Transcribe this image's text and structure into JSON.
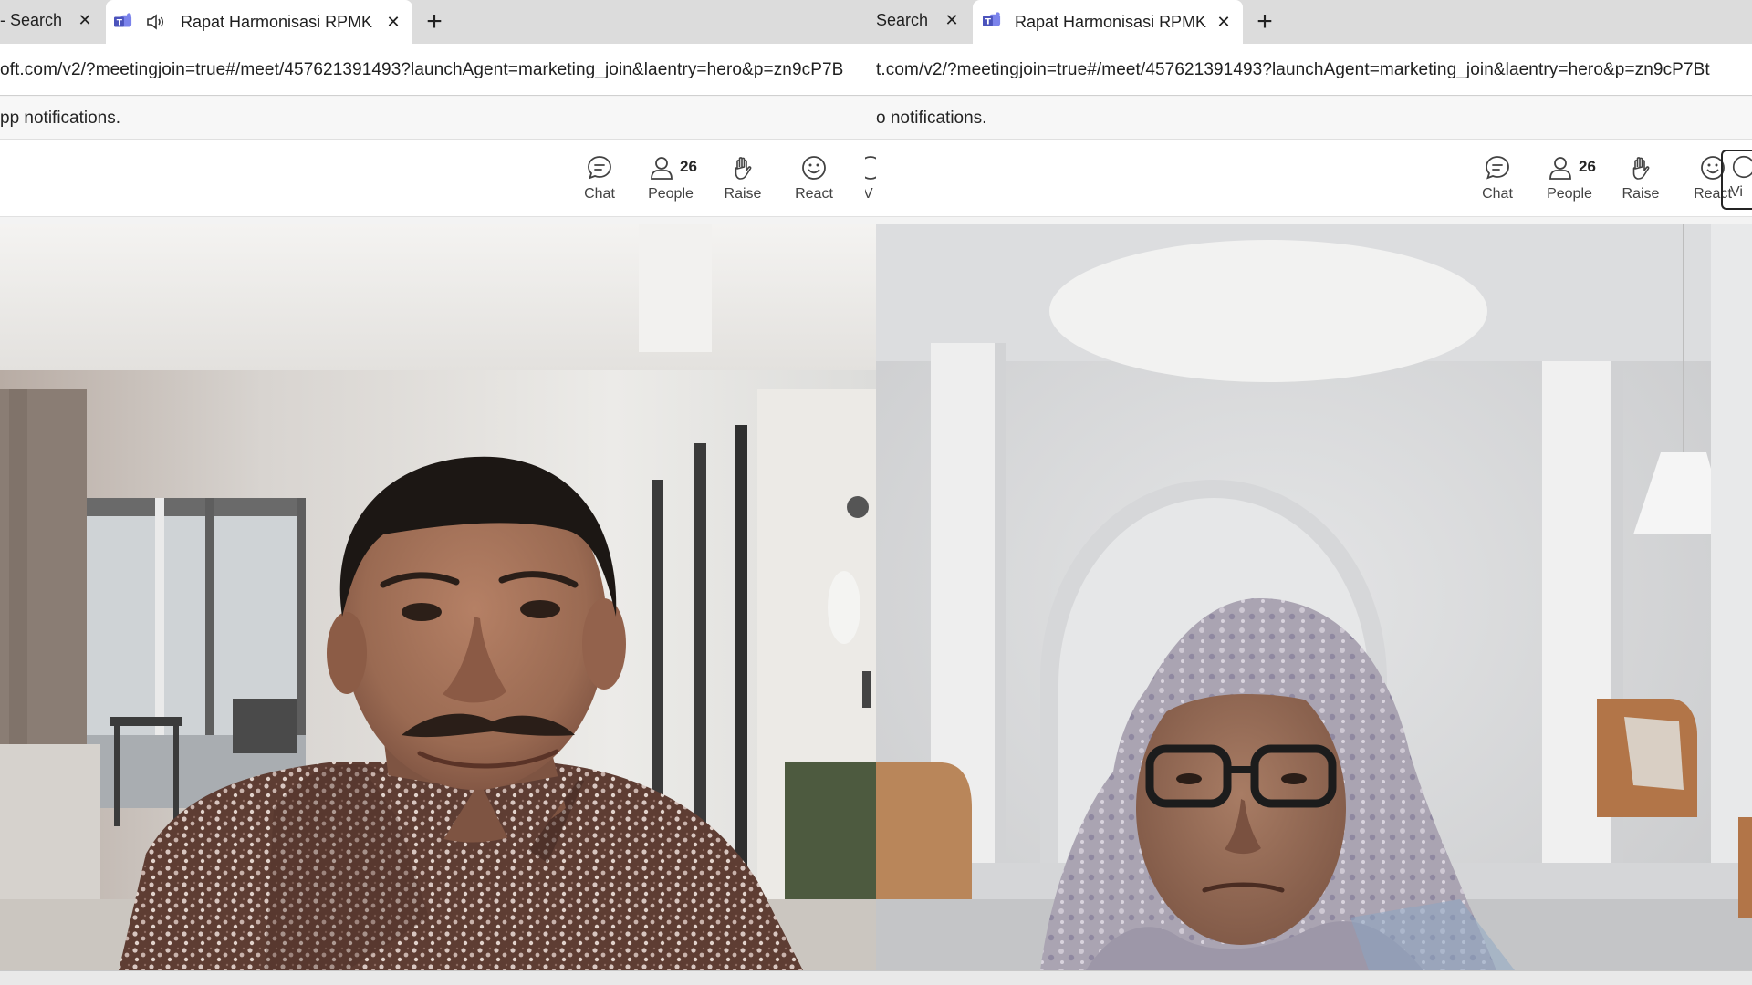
{
  "left": {
    "tabs": [
      {
        "label": "- Search",
        "close": "✕"
      },
      {
        "label": "Rapat Harmonisasi RPMK Ma",
        "close": "✕",
        "active": true,
        "audio": true
      }
    ],
    "new_tab": "+",
    "url_text": "oft.com/v2/?meetingjoin=true#/meet/457621391493?launchAgent=marketing_join&laentry=hero&p=zn9cP7B",
    "notification_text": "pp notifications.",
    "toolbar": {
      "chat": "Chat",
      "people": "People",
      "people_count": "26",
      "raise": "Raise",
      "react": "React",
      "view_partial": "V"
    }
  },
  "right": {
    "tabs": [
      {
        "label": "Search",
        "close": "✕"
      },
      {
        "label": "Rapat Harmonisasi RPMK Manaje",
        "close": "✕",
        "active": true
      }
    ],
    "new_tab": "+",
    "url_text": "t.com/v2/?meetingjoin=true#/meet/457621391493?launchAgent=marketing_join&laentry=hero&p=zn9cP7Bt",
    "notification_text": "o notifications.",
    "toolbar": {
      "chat": "Chat",
      "people": "People",
      "people_count": "26",
      "raise": "Raise",
      "react": "React",
      "view_partial": "Vi"
    }
  },
  "colors": {
    "teams_brand": "#5b5fc7",
    "tabstrip": "#dcdcdc",
    "toolbar_bg": "#ffffff"
  }
}
